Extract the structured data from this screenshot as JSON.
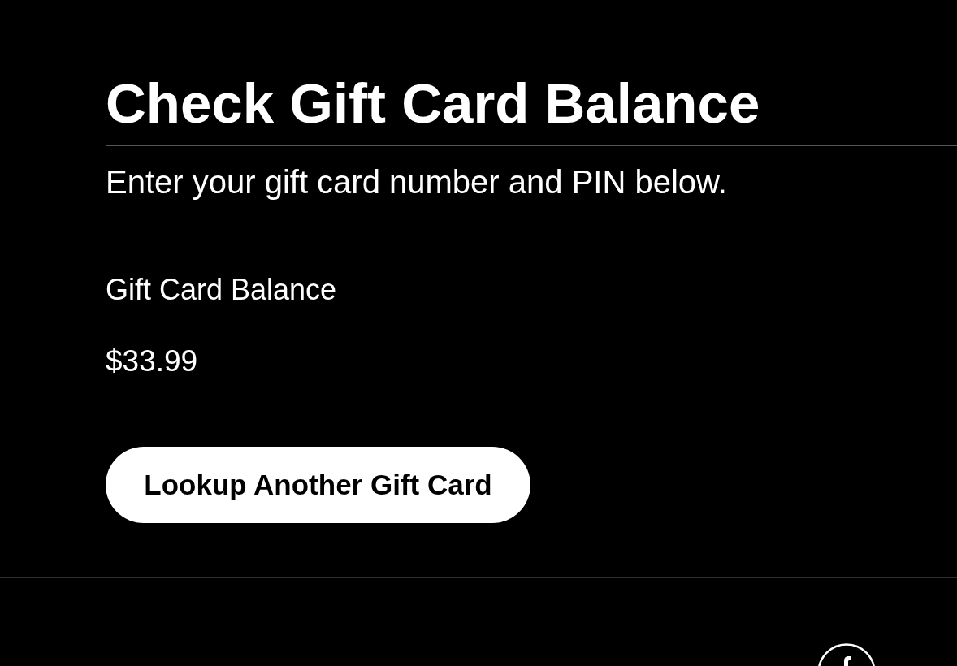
{
  "heading": "Check Gift Card Balance",
  "instructions": "Enter your gift card number and PIN below.",
  "balance": {
    "label": "Gift Card Balance",
    "amount": "$33.99"
  },
  "button": "Lookup Another Gift Card"
}
